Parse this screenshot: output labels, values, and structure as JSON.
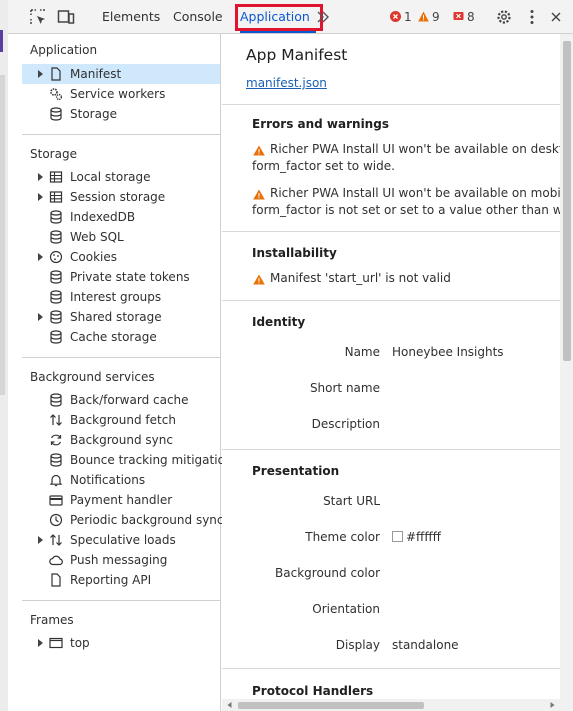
{
  "toolbar": {
    "tabs": [
      "Elements",
      "Console",
      "Application"
    ],
    "error_count": "1",
    "warning_count": "9",
    "issue_count": "8",
    "icons": [
      "inspect-element-icon",
      "device-toolbar-icon",
      "more-tabs-icon",
      "settings-icon",
      "more-options-icon"
    ]
  },
  "sidebar": {
    "application": {
      "title": "Application",
      "items": [
        {
          "label": "Manifest",
          "icon": "file-icon"
        },
        {
          "label": "Service workers",
          "icon": "gears-icon"
        },
        {
          "label": "Storage",
          "icon": "database-icon"
        }
      ]
    },
    "storage": {
      "title": "Storage",
      "items": [
        {
          "label": "Local storage",
          "icon": "table-icon"
        },
        {
          "label": "Session storage",
          "icon": "table-icon"
        },
        {
          "label": "IndexedDB",
          "icon": "database-icon"
        },
        {
          "label": "Web SQL",
          "icon": "database-icon"
        },
        {
          "label": "Cookies",
          "icon": "cookie-icon"
        },
        {
          "label": "Private state tokens",
          "icon": "database-icon"
        },
        {
          "label": "Interest groups",
          "icon": "database-icon"
        },
        {
          "label": "Shared storage",
          "icon": "database-icon"
        },
        {
          "label": "Cache storage",
          "icon": "database-icon"
        }
      ]
    },
    "background": {
      "title": "Background services",
      "items": [
        {
          "label": "Back/forward cache",
          "icon": "database-icon"
        },
        {
          "label": "Background fetch",
          "icon": "arrows-updown-icon"
        },
        {
          "label": "Background sync",
          "icon": "sync-icon"
        },
        {
          "label": "Bounce tracking mitigations",
          "icon": "database-icon"
        },
        {
          "label": "Notifications",
          "icon": "bell-icon"
        },
        {
          "label": "Payment handler",
          "icon": "card-icon"
        },
        {
          "label": "Periodic background sync",
          "icon": "clock-icon"
        },
        {
          "label": "Speculative loads",
          "icon": "arrows-updown-icon"
        },
        {
          "label": "Push messaging",
          "icon": "cloud-icon"
        },
        {
          "label": "Reporting API",
          "icon": "file-icon"
        }
      ]
    },
    "frames": {
      "title": "Frames",
      "items": [
        {
          "label": "top",
          "icon": "frame-icon"
        }
      ]
    }
  },
  "main": {
    "title": "App Manifest",
    "manifest_link": "manifest.json",
    "errors": {
      "header": "Errors and warnings",
      "items": [
        {
          "line1": "Richer PWA Install UI won't be available on desktop. Ple",
          "line2": "form_factor set to wide."
        },
        {
          "line1": "Richer PWA Install UI won't be available on mobile. Plea",
          "line2": "form_factor is not set or set to a value other than wide."
        }
      ]
    },
    "installability": {
      "header": "Installability",
      "items": [
        "Manifest 'start_url' is not valid"
      ]
    },
    "identity": {
      "header": "Identity",
      "name_label": "Name",
      "name_value": "Honeybee Insights",
      "short_name_label": "Short name",
      "description_label": "Description"
    },
    "presentation": {
      "header": "Presentation",
      "start_url_label": "Start URL",
      "theme_color_label": "Theme color",
      "theme_color_value": "#ffffff",
      "background_color_label": "Background color",
      "orientation_label": "Orientation",
      "display_label": "Display",
      "display_value": "standalone"
    },
    "protocol": {
      "header": "Protocol Handlers"
    }
  },
  "colors": {
    "accent": "#0b57d0",
    "highlight_box": "#e0142f",
    "selected_row": "#cfe8fc",
    "error": "#dc362e",
    "warning": "#e8710a"
  }
}
